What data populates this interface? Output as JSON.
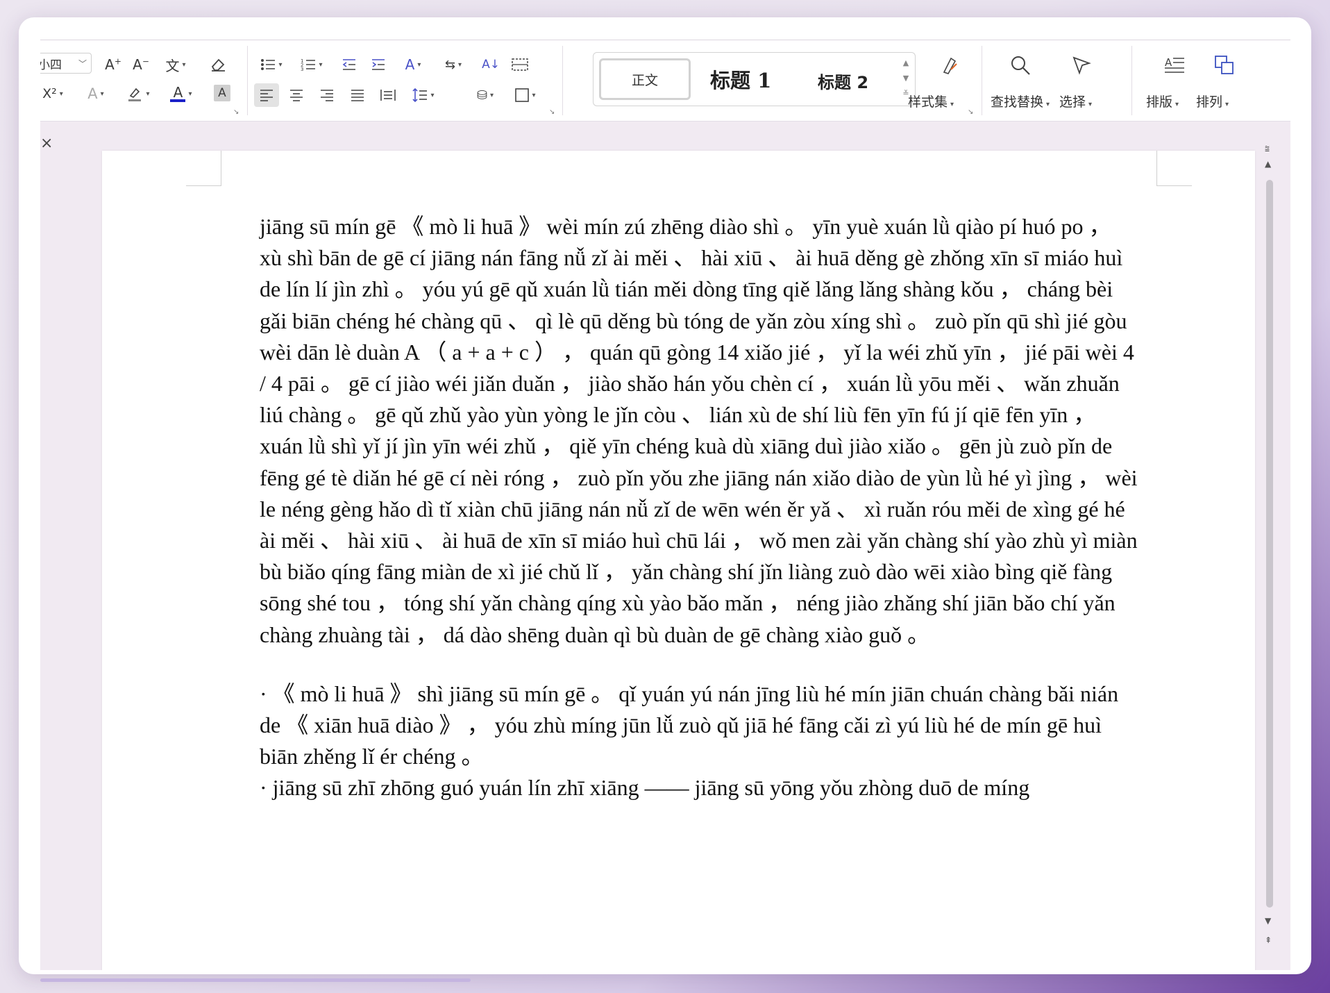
{
  "ribbon": {
    "font_size_value": "小四",
    "styles": {
      "normal": "正文",
      "heading1": "标题 1",
      "heading2": "标题 2"
    },
    "style_set_label": "样式集",
    "find_replace_label": "查找替换",
    "select_label": "选择",
    "layout_label": "排版",
    "arrange_label": "排列",
    "font_color": "#1a20c8",
    "superscript_label": "X²"
  },
  "document": {
    "paragraph1": "jiāng sū mín gē 《 mò li huā 》 wèi mín zú zhēng diào shì 。 yīn yuè xuán lǜ qiào pí huó po ， xù shì bān de gē cí jiāng nán fāng nǚ zǐ ài měi 、 hài xiū 、 ài huā děng gè zhǒng xīn sī miáo huì de lín lí jìn zhì 。 yóu yú gē qǔ xuán lǜ tián měi dòng tīng qiě lǎng lǎng shàng kǒu ， cháng bèi gǎi biān chéng hé chàng qū 、 qì lè qū děng bù tóng de yǎn zòu xíng shì 。 zuò pǐn qū shì jié gòu wèi dān lè duàn A （ a + a + c ） ， quán qū gòng 14 xiǎo jié ， yǐ la wéi zhǔ yīn ， jié pāi wèi 4 / 4 pāi 。 gē cí jiào wéi jiǎn duǎn ， jiào shǎo hán yǒu chèn cí ， xuán lǜ yōu měi 、 wǎn zhuǎn liú chàng 。 gē qǔ zhǔ yào yùn yòng le jǐn còu 、 lián xù de shí liù fēn yīn fú jí qiē fēn yīn ， xuán lǜ shì yǐ jí jìn yīn wéi zhǔ ， qiě yīn chéng kuà dù xiāng duì jiào xiǎo 。 gēn jù zuò pǐn de fēng gé tè diǎn hé gē cí nèi róng ， zuò pǐn yǒu zhe jiāng nán xiǎo diào de yùn lǜ hé yì jìng ， wèi le néng gèng hǎo dì tǐ xiàn chū jiāng nán nǚ zǐ de wēn wén ěr yǎ 、 xì ruǎn róu měi de xìng gé hé ài měi 、 hài xiū 、 ài huā de xīn sī miáo huì chū lái ， wǒ men zài yǎn chàng shí yào zhù yì miàn bù biǎo qíng fāng miàn de xì jié chǔ lǐ ， yǎn chàng shí jǐn liàng zuò dào wēi xiào bìng qiě fàng sōng shé tou ， tóng shí yǎn chàng qíng xù yào bǎo mǎn ， néng jiào zhǎng shí jiān bǎo chí yǎn chàng zhuàng tài ， dá dào shēng duàn qì bù duàn de gē chàng xiào guǒ 。",
    "bullet1": " · 《 mò li huā 》 shì jiāng sū mín gē 。 qǐ yuán yú nán jīng liù hé mín jiān chuán chàng bǎi nián de 《 xiān huā diào 》 ， yóu zhù míng jūn lǚ zuò qǔ jiā hé fāng cǎi zì yú liù hé de mín gē huì biān zhěng lǐ ér chéng 。",
    "bullet2": " · jiāng sū zhī zhōng guó yuán lín zhī xiāng —— jiāng sū yōng yǒu zhòng duō de míng"
  }
}
